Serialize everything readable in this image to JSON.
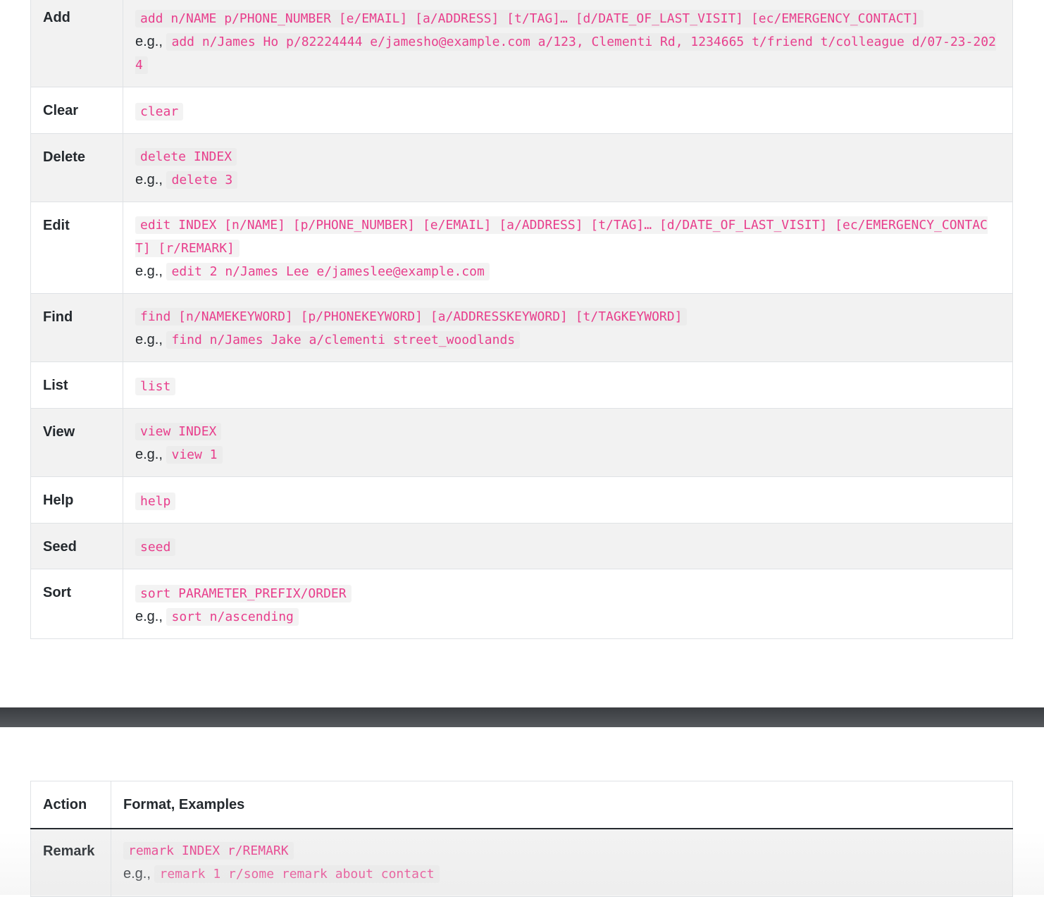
{
  "command_table": {
    "rows": [
      {
        "action": "Add",
        "format": "add n/NAME p/PHONE_NUMBER [e/EMAIL] [a/ADDRESS] [t/TAG]… [d/DATE_OF_LAST_VISIT] [ec/EMERGENCY_CONTACT]",
        "eg_label": "e.g.,",
        "example": "add n/James Ho p/82224444 e/jamesho@example.com a/123, Clementi Rd, 1234665 t/friend t/colleague d/07-23-2024"
      },
      {
        "action": "Clear",
        "format": "clear"
      },
      {
        "action": "Delete",
        "format": "delete INDEX",
        "eg_label": "e.g.,",
        "example": "delete 3"
      },
      {
        "action": "Edit",
        "format": "edit INDEX [n/NAME] [p/PHONE_NUMBER] [e/EMAIL] [a/ADDRESS] [t/TAG]… [d/DATE_OF_LAST_VISIT] [ec/EMERGENCY_CONTACT] [r/REMARK]",
        "eg_label": "e.g.,",
        "example": "edit 2 n/James Lee e/jameslee@example.com"
      },
      {
        "action": "Find",
        "format": "find [n/NAMEKEYWORD] [p/PHONEKEYWORD] [a/ADDRESSKEYWORD] [t/TAGKEYWORD]",
        "eg_label": "e.g.,",
        "example": "find n/James Jake a/clementi street_woodlands"
      },
      {
        "action": "List",
        "format": "list"
      },
      {
        "action": "View",
        "format": "view INDEX",
        "eg_label": "e.g.,",
        "example": "view 1"
      },
      {
        "action": "Help",
        "format": "help"
      },
      {
        "action": "Seed",
        "format": "seed"
      },
      {
        "action": "Sort",
        "format": "sort PARAMETER_PREFIX/ORDER",
        "eg_label": "e.g.,",
        "example": "sort n/ascending"
      }
    ]
  },
  "second_table": {
    "headers": {
      "action": "Action",
      "format": "Format, Examples"
    },
    "rows": [
      {
        "action": "Remark",
        "format": "remark INDEX r/REMARK",
        "eg_label": "e.g.,",
        "example": "remark 1 r/some remark about contact"
      }
    ]
  }
}
